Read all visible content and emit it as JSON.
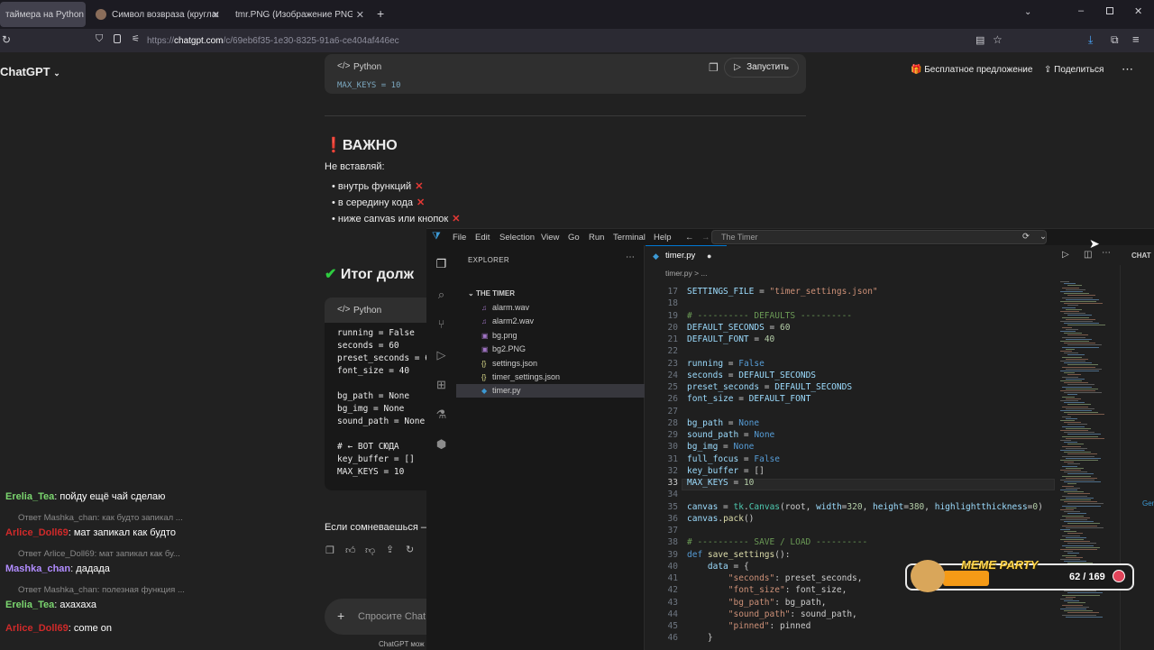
{
  "browser": {
    "tabs": [
      {
        "label": "таймера на Python"
      },
      {
        "label": "Символ возвраза (круглая стр"
      },
      {
        "label": "tmr.PNG (Изображение PNG, 1465"
      }
    ],
    "new_tab": "+",
    "url_prefix": "https://",
    "url_domain": "chatgpt.com",
    "url_path": "/c/69eb6f35-1e30-8325-91a6-ce404af446ec"
  },
  "chatgpt": {
    "title": "ChatGPT",
    "free_offer": "Бесплатное предложение",
    "share": "Поделиться",
    "code_lang": "Python",
    "run_label": "Запустить",
    "code_top_line": "MAX_KEYS = 10",
    "important_heading": "ВАЖНО",
    "dont_insert": "Не вставляй:",
    "bullets": [
      "внутрь функций",
      "в середину кода",
      "ниже canvas или кнопок"
    ],
    "result_heading": "Итог долж",
    "code2_lang": "Python",
    "code2_lines": [
      "running = False",
      "seconds = 60",
      "preset_seconds = 6",
      "font_size = 40",
      "",
      "bg_path = None",
      "bg_img = None",
      "sound_path = None",
      "",
      "# ← ВОТ СЮДА",
      "key_buffer = []",
      "MAX_KEYS = 10"
    ],
    "doubt_text": "Если сомневаешься —",
    "input_placeholder": "Спросите Chat",
    "footer_note": "ChatGPT мож"
  },
  "chat_overlay": [
    {
      "user": "Erelia_Tea",
      "text": "пойду ещё чай сделаю",
      "color": "#7bd66f"
    },
    {
      "reply": "Ответ Mashka_chan: как будто запикал ..."
    },
    {
      "user": "Arlice_Doll69",
      "text": "мат запикал как будто",
      "color": "#d02a2a"
    },
    {
      "reply": "Ответ Arlice_Doll69: мат запикал как бу..."
    },
    {
      "user": "Mashka_chan",
      "text": "дадада",
      "color": "#b18cff"
    },
    {
      "reply": "Ответ Mashka_chan: полезная функция ..."
    },
    {
      "user": "Erelia_Tea",
      "text": "ахахаха",
      "color": "#7bd66f"
    },
    {
      "user": "Arlice_Doll69",
      "text": "come on",
      "color": "#d02a2a"
    }
  ],
  "vscode": {
    "menu": [
      "File",
      "Edit",
      "Selection",
      "View",
      "Go",
      "Run",
      "Terminal",
      "Help"
    ],
    "search": "The Timer",
    "explorer_title": "EXPLORER",
    "folder": "THE TIMER",
    "files": [
      "alarm.wav",
      "alarm2.wav",
      "bg.png",
      "bg2.PNG",
      "settings.json",
      "timer_settings.json",
      "timer.py"
    ],
    "active_tab": "timer.py",
    "breadcrumb": "timer.py > ...",
    "chat_label": "CHAT",
    "side_label": "Gen",
    "line_numbers": [
      17,
      18,
      19,
      20,
      21,
      22,
      23,
      24,
      25,
      26,
      27,
      28,
      29,
      30,
      31,
      32,
      33,
      34,
      35,
      36,
      37,
      38,
      39,
      40,
      41,
      42,
      43,
      44,
      45,
      46
    ],
    "current_line": 33
  },
  "meme_party": {
    "title": "MEME PARTY",
    "count": "62 / 169",
    "progress": 0.367
  }
}
